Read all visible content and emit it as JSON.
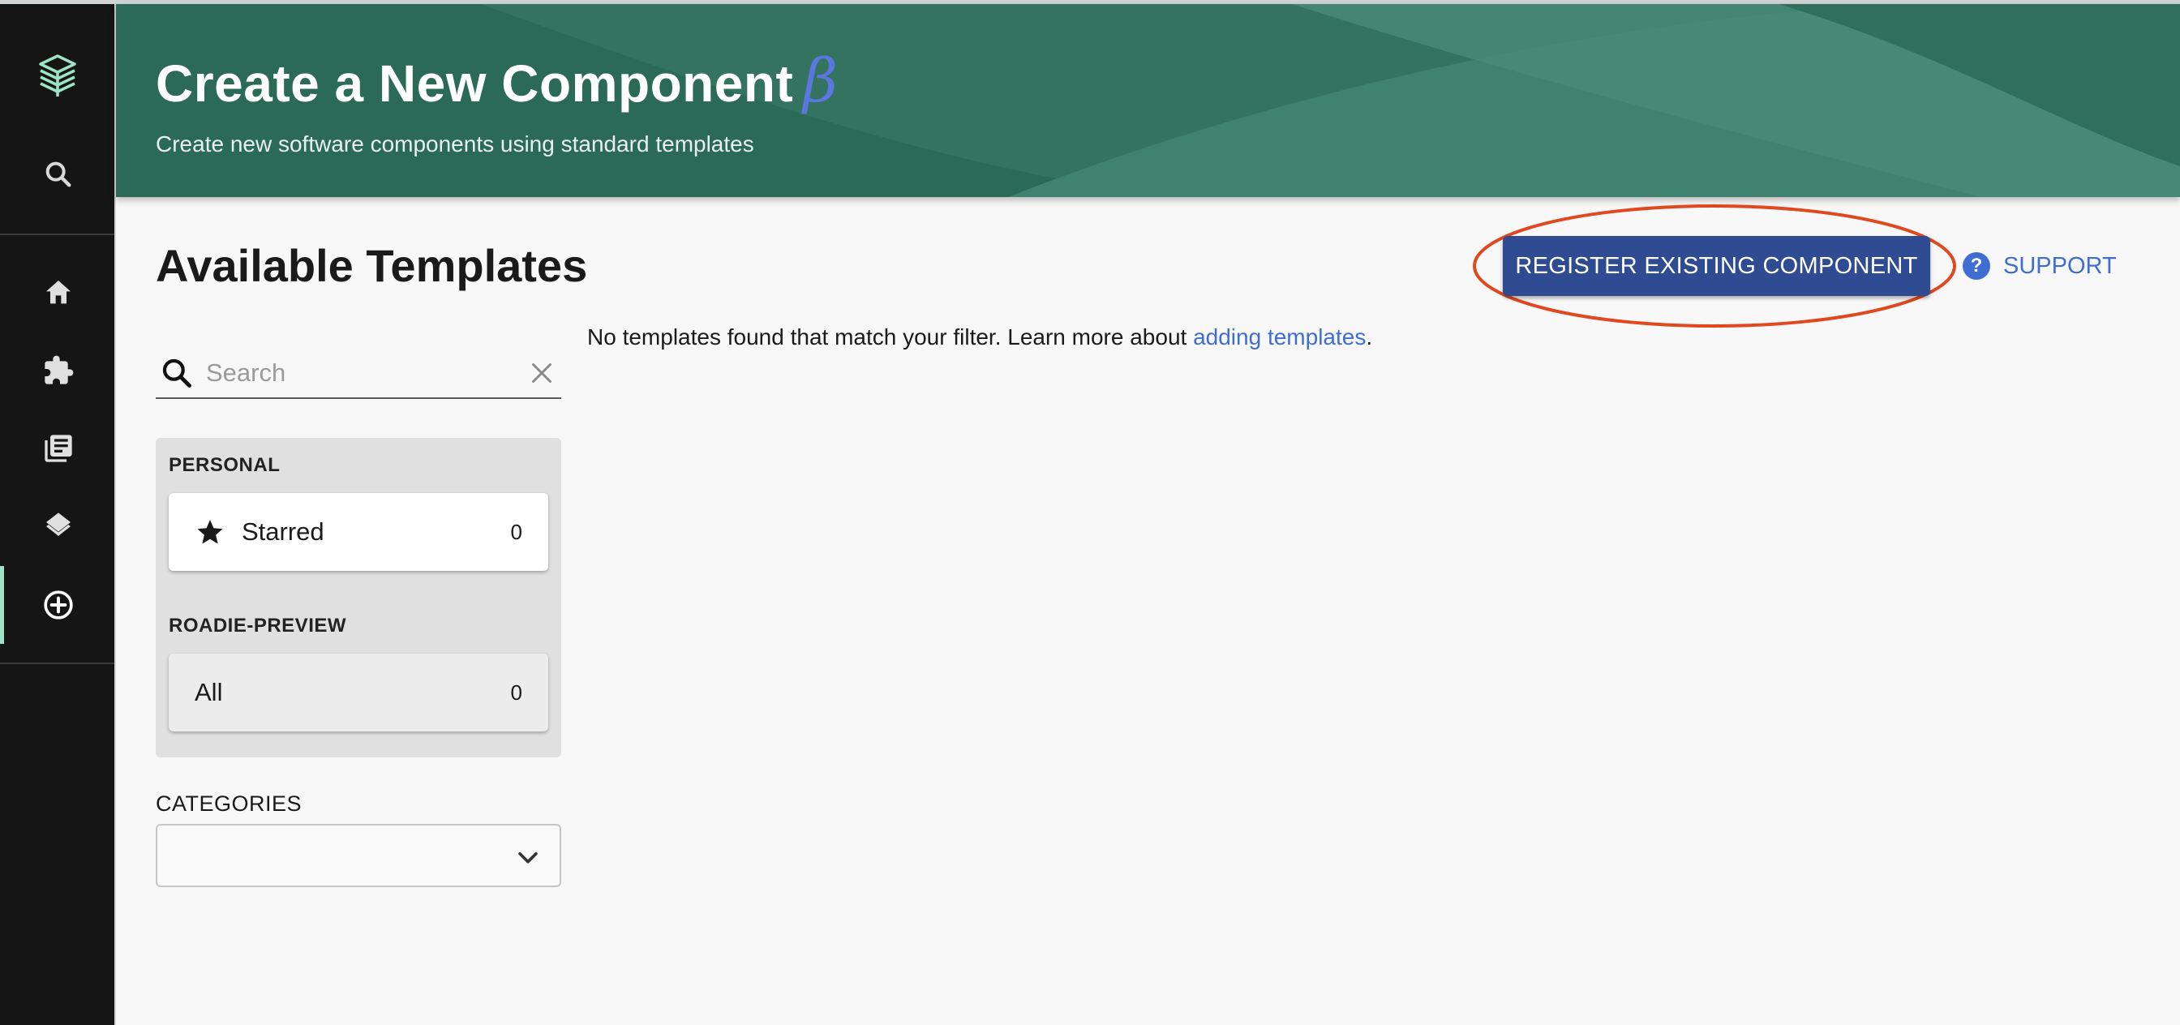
{
  "banner": {
    "title": "Create a New Component",
    "beta_symbol": "β",
    "subtitle": "Create new software components using standard templates"
  },
  "sidebar": {
    "items": [
      {
        "icon": "logo-icon"
      },
      {
        "icon": "search-icon"
      },
      {
        "icon": "home-icon"
      },
      {
        "icon": "puzzle-icon"
      },
      {
        "icon": "docs-icon"
      },
      {
        "icon": "layers-icon"
      },
      {
        "icon": "create-plus-icon",
        "active": true
      }
    ]
  },
  "main": {
    "title": "Available Templates",
    "register_button": "REGISTER EXISTING COMPONENT",
    "support_label": "SUPPORT",
    "empty_message": "No templates found that match your filter. Learn more about",
    "empty_link": "adding templates",
    "empty_suffix": "."
  },
  "search": {
    "placeholder": "Search"
  },
  "filters": {
    "personal_label": "PERSONAL",
    "starred": {
      "label": "Starred",
      "count": "0"
    },
    "org_label": "ROADIE-PREVIEW",
    "all": {
      "label": "All",
      "count": "0"
    }
  },
  "categories": {
    "label": "CATEGORIES",
    "selected": ""
  },
  "colors": {
    "banner": "#2b6a56",
    "sidebar": "#151515",
    "accent": "#9ce3c7",
    "primary_button": "#2f4b91",
    "link": "#3f6ed3",
    "highlight": "#e0481f"
  }
}
